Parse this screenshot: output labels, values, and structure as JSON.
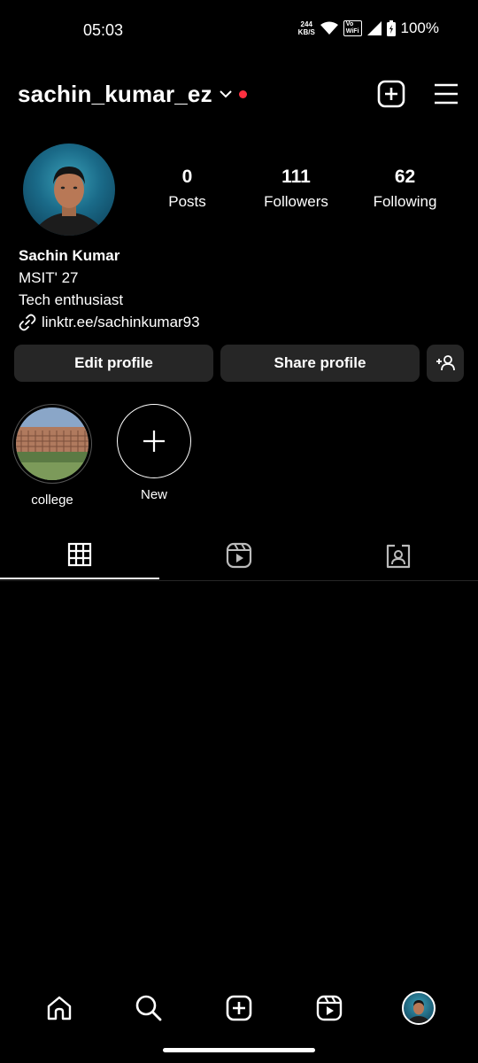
{
  "status_bar": {
    "time": "05:03",
    "net_speed_value": "244",
    "net_speed_unit": "KB/S",
    "vowifi_top": "Vo",
    "vowifi_bottom": "WiFi",
    "battery": "100%"
  },
  "header": {
    "username": "sachin_kumar_ez",
    "notification_color": "#ff3040"
  },
  "stats": [
    {
      "value": "0",
      "label": "Posts"
    },
    {
      "value": "111",
      "label": "Followers"
    },
    {
      "value": "62",
      "label": "Following"
    }
  ],
  "bio": {
    "name": "Sachin Kumar",
    "line1": "MSIT' 27",
    "line2": "Tech enthusiast",
    "link": "linktr.ee/sachinkumar93"
  },
  "buttons": {
    "edit": "Edit profile",
    "share": "Share profile"
  },
  "highlights": [
    {
      "label": "college"
    },
    {
      "label": "New"
    }
  ],
  "tabs": [
    "grid-icon",
    "reels-icon",
    "tagged-icon"
  ],
  "nav": [
    "home-icon",
    "search-icon",
    "create-icon",
    "reels-icon",
    "profile-avatar"
  ]
}
